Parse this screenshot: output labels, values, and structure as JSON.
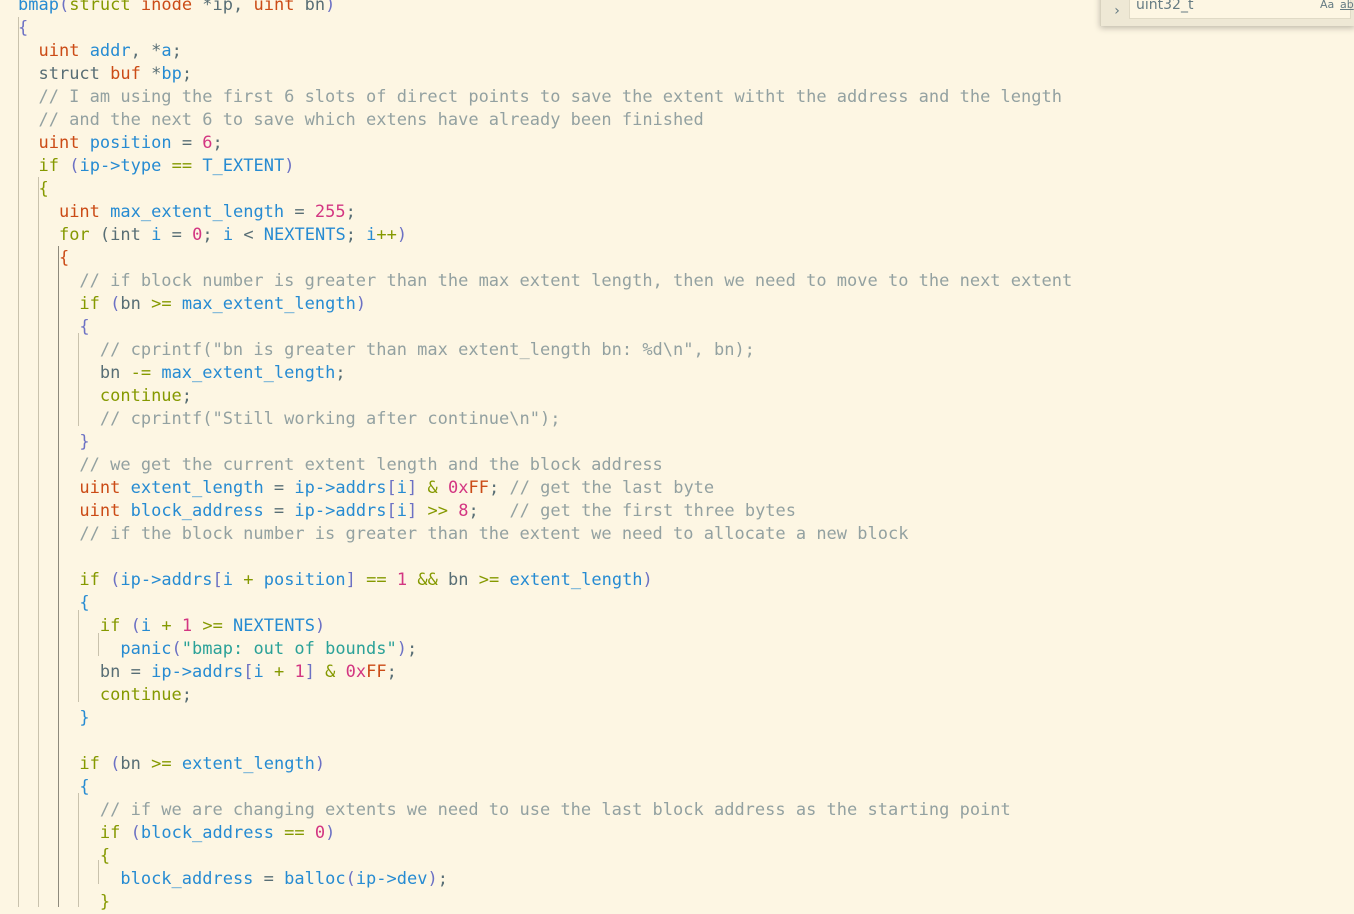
{
  "colors": {
    "background": "#fdf6e3",
    "text": "#586e75",
    "keyword": "#859900",
    "type": "#cb4b16",
    "variable": "#268bd2",
    "number": "#d33682",
    "string": "#2aa198",
    "comment": "#93a1a1",
    "bracket": "#6c71c4"
  },
  "find_widget": {
    "value": "uint32_t",
    "toggle_icon": "chevron-right-icon",
    "match_case_label": "Aa",
    "whole_word_label": "ab"
  },
  "code_lines": [
    [
      [
        "bmap",
        "#268bd2"
      ],
      [
        "(",
        "#6c71c4"
      ],
      [
        "struct",
        "#859900"
      ],
      [
        " ",
        "#586e75"
      ],
      [
        "inode",
        "#cb4b16"
      ],
      [
        " *ip, ",
        "#586e75"
      ],
      [
        "uint",
        "#cb4b16"
      ],
      [
        " bn",
        "#586e75"
      ],
      [
        ")",
        "#6c71c4"
      ]
    ],
    [
      [
        "{",
        "#6c71c4"
      ]
    ],
    [
      [
        "  ",
        "#586e75"
      ],
      [
        "uint",
        "#cb4b16"
      ],
      [
        " ",
        "#586e75"
      ],
      [
        "addr",
        "#268bd2"
      ],
      [
        ", *",
        "#586e75"
      ],
      [
        "a",
        "#268bd2"
      ],
      [
        ";",
        "#586e75"
      ]
    ],
    [
      [
        "  ",
        "#586e75"
      ],
      [
        "struct",
        "#586e75"
      ],
      [
        " ",
        "#586e75"
      ],
      [
        "buf",
        "#cb4b16"
      ],
      [
        " *",
        "#586e75"
      ],
      [
        "bp",
        "#268bd2"
      ],
      [
        ";",
        "#586e75"
      ]
    ],
    [
      [
        "  // I am using the first 6 slots of direct points to save the extent witht the address and the length",
        "#93a1a1"
      ]
    ],
    [
      [
        "  // and the next 6 to save which extens have already been finished",
        "#93a1a1"
      ]
    ],
    [
      [
        "  ",
        "#586e75"
      ],
      [
        "uint",
        "#cb4b16"
      ],
      [
        " ",
        "#586e75"
      ],
      [
        "position",
        "#268bd2"
      ],
      [
        " = ",
        "#586e75"
      ],
      [
        "6",
        "#d33682"
      ],
      [
        ";",
        "#586e75"
      ]
    ],
    [
      [
        "  ",
        "#586e75"
      ],
      [
        "if",
        "#859900"
      ],
      [
        " ",
        "#586e75"
      ],
      [
        "(",
        "#6c71c4"
      ],
      [
        "ip->type",
        "#268bd2"
      ],
      [
        " == ",
        "#859900"
      ],
      [
        "T_EXTENT",
        "#268bd2"
      ],
      [
        ")",
        "#6c71c4"
      ]
    ],
    [
      [
        "  ",
        "#586e75"
      ],
      [
        "{",
        "#859900"
      ]
    ],
    [
      [
        "    ",
        "#586e75"
      ],
      [
        "uint",
        "#cb4b16"
      ],
      [
        " ",
        "#586e75"
      ],
      [
        "max_extent_length",
        "#268bd2"
      ],
      [
        " = ",
        "#586e75"
      ],
      [
        "255",
        "#d33682"
      ],
      [
        ";",
        "#586e75"
      ]
    ],
    [
      [
        "    ",
        "#586e75"
      ],
      [
        "for",
        "#859900"
      ],
      [
        " (",
        "#586e75"
      ],
      [
        "int",
        "#586e75"
      ],
      [
        " ",
        "#586e75"
      ],
      [
        "i",
        "#268bd2"
      ],
      [
        " = ",
        "#586e75"
      ],
      [
        "0",
        "#d33682"
      ],
      [
        "; ",
        "#586e75"
      ],
      [
        "i",
        "#268bd2"
      ],
      [
        " < ",
        "#586e75"
      ],
      [
        "NEXTENTS",
        "#268bd2"
      ],
      [
        "; ",
        "#586e75"
      ],
      [
        "i",
        "#268bd2"
      ],
      [
        "++",
        "#859900"
      ],
      [
        ")",
        "#6c71c4"
      ]
    ],
    [
      [
        "    ",
        "#586e75"
      ],
      [
        "{",
        "#cb4b16"
      ]
    ],
    [
      [
        "      // if block number is greater than the max extent length, then we need to move to the next extent",
        "#93a1a1"
      ]
    ],
    [
      [
        "      ",
        "#586e75"
      ],
      [
        "if",
        "#859900"
      ],
      [
        " ",
        "#586e75"
      ],
      [
        "(",
        "#6c71c4"
      ],
      [
        "bn",
        "#586e75"
      ],
      [
        " >= ",
        "#859900"
      ],
      [
        "max_extent_length",
        "#268bd2"
      ],
      [
        ")",
        "#6c71c4"
      ]
    ],
    [
      [
        "      ",
        "#586e75"
      ],
      [
        "{",
        "#6c71c4"
      ]
    ],
    [
      [
        "        // cprintf(\"bn is greater than max extent_length bn: %d\\n\", bn);",
        "#93a1a1"
      ]
    ],
    [
      [
        "        ",
        "#586e75"
      ],
      [
        "bn",
        "#586e75"
      ],
      [
        " -= ",
        "#859900"
      ],
      [
        "max_extent_length",
        "#268bd2"
      ],
      [
        ";",
        "#586e75"
      ]
    ],
    [
      [
        "        ",
        "#586e75"
      ],
      [
        "continue",
        "#859900"
      ],
      [
        ";",
        "#586e75"
      ]
    ],
    [
      [
        "        // cprintf(\"Still working after continue\\n\");",
        "#93a1a1"
      ]
    ],
    [
      [
        "      ",
        "#586e75"
      ],
      [
        "}",
        "#6c71c4"
      ]
    ],
    [
      [
        "      // we get the current extent length and the block address",
        "#93a1a1"
      ]
    ],
    [
      [
        "      ",
        "#586e75"
      ],
      [
        "uint",
        "#cb4b16"
      ],
      [
        " ",
        "#586e75"
      ],
      [
        "extent_length",
        "#268bd2"
      ],
      [
        " = ",
        "#586e75"
      ],
      [
        "ip->addrs",
        "#268bd2"
      ],
      [
        "[",
        "#6c71c4"
      ],
      [
        "i",
        "#268bd2"
      ],
      [
        "]",
        "#6c71c4"
      ],
      [
        " & ",
        "#859900"
      ],
      [
        "0x",
        "#d33682"
      ],
      [
        "FF",
        "#cb4b16"
      ],
      [
        "; ",
        "#586e75"
      ],
      [
        "// get the last byte",
        "#93a1a1"
      ]
    ],
    [
      [
        "      ",
        "#586e75"
      ],
      [
        "uint",
        "#cb4b16"
      ],
      [
        " ",
        "#586e75"
      ],
      [
        "block_address",
        "#268bd2"
      ],
      [
        " = ",
        "#586e75"
      ],
      [
        "ip->addrs",
        "#268bd2"
      ],
      [
        "[",
        "#6c71c4"
      ],
      [
        "i",
        "#268bd2"
      ],
      [
        "]",
        "#6c71c4"
      ],
      [
        " >> ",
        "#859900"
      ],
      [
        "8",
        "#d33682"
      ],
      [
        ";   ",
        "#586e75"
      ],
      [
        "// get the first three bytes",
        "#93a1a1"
      ]
    ],
    [
      [
        "      // if the block number is greater than the extent we need to allocate a new block",
        "#93a1a1"
      ]
    ],
    [
      [
        "",
        "#586e75"
      ]
    ],
    [
      [
        "      ",
        "#586e75"
      ],
      [
        "if",
        "#859900"
      ],
      [
        " ",
        "#586e75"
      ],
      [
        "(",
        "#6c71c4"
      ],
      [
        "ip->addrs",
        "#268bd2"
      ],
      [
        "[",
        "#6c71c4"
      ],
      [
        "i",
        "#268bd2"
      ],
      [
        " + ",
        "#859900"
      ],
      [
        "position",
        "#268bd2"
      ],
      [
        "]",
        "#6c71c4"
      ],
      [
        " == ",
        "#859900"
      ],
      [
        "1",
        "#d33682"
      ],
      [
        " && ",
        "#859900"
      ],
      [
        "bn",
        "#586e75"
      ],
      [
        " >= ",
        "#859900"
      ],
      [
        "extent_length",
        "#268bd2"
      ],
      [
        ")",
        "#6c71c4"
      ]
    ],
    [
      [
        "      ",
        "#586e75"
      ],
      [
        "{",
        "#268bd2"
      ]
    ],
    [
      [
        "        ",
        "#586e75"
      ],
      [
        "if",
        "#859900"
      ],
      [
        " ",
        "#586e75"
      ],
      [
        "(",
        "#6c71c4"
      ],
      [
        "i",
        "#268bd2"
      ],
      [
        " + ",
        "#859900"
      ],
      [
        "1",
        "#d33682"
      ],
      [
        " >= ",
        "#859900"
      ],
      [
        "NEXTENTS",
        "#268bd2"
      ],
      [
        ")",
        "#6c71c4"
      ]
    ],
    [
      [
        "          ",
        "#586e75"
      ],
      [
        "panic",
        "#268bd2"
      ],
      [
        "(",
        "#6c71c4"
      ],
      [
        "\"bmap: out of bounds\"",
        "#2aa198"
      ],
      [
        ")",
        "#6c71c4"
      ],
      [
        ";",
        "#586e75"
      ]
    ],
    [
      [
        "        ",
        "#586e75"
      ],
      [
        "bn",
        "#586e75"
      ],
      [
        " = ",
        "#586e75"
      ],
      [
        "ip->addrs",
        "#268bd2"
      ],
      [
        "[",
        "#6c71c4"
      ],
      [
        "i",
        "#268bd2"
      ],
      [
        " + ",
        "#859900"
      ],
      [
        "1",
        "#d33682"
      ],
      [
        "]",
        "#6c71c4"
      ],
      [
        " & ",
        "#859900"
      ],
      [
        "0x",
        "#d33682"
      ],
      [
        "FF",
        "#cb4b16"
      ],
      [
        ";",
        "#586e75"
      ]
    ],
    [
      [
        "        ",
        "#586e75"
      ],
      [
        "continue",
        "#859900"
      ],
      [
        ";",
        "#586e75"
      ]
    ],
    [
      [
        "      ",
        "#586e75"
      ],
      [
        "}",
        "#268bd2"
      ]
    ],
    [
      [
        "",
        "#586e75"
      ]
    ],
    [
      [
        "      ",
        "#586e75"
      ],
      [
        "if",
        "#859900"
      ],
      [
        " ",
        "#586e75"
      ],
      [
        "(",
        "#6c71c4"
      ],
      [
        "bn",
        "#586e75"
      ],
      [
        " >= ",
        "#859900"
      ],
      [
        "extent_length",
        "#268bd2"
      ],
      [
        ")",
        "#6c71c4"
      ]
    ],
    [
      [
        "      ",
        "#586e75"
      ],
      [
        "{",
        "#268bd2"
      ]
    ],
    [
      [
        "        // if we are changing extents we need to use the last block address as the starting point",
        "#93a1a1"
      ]
    ],
    [
      [
        "        ",
        "#586e75"
      ],
      [
        "if",
        "#859900"
      ],
      [
        " ",
        "#586e75"
      ],
      [
        "(",
        "#6c71c4"
      ],
      [
        "block_address",
        "#268bd2"
      ],
      [
        " == ",
        "#859900"
      ],
      [
        "0",
        "#d33682"
      ],
      [
        ")",
        "#6c71c4"
      ]
    ],
    [
      [
        "        ",
        "#586e75"
      ],
      [
        "{",
        "#859900"
      ]
    ],
    [
      [
        "          ",
        "#586e75"
      ],
      [
        "block_address",
        "#268bd2"
      ],
      [
        " = ",
        "#586e75"
      ],
      [
        "balloc",
        "#268bd2"
      ],
      [
        "(",
        "#6c71c4"
      ],
      [
        "ip->dev",
        "#268bd2"
      ],
      [
        ")",
        "#6c71c4"
      ],
      [
        ";",
        "#586e75"
      ]
    ],
    [
      [
        "        ",
        "#586e75"
      ],
      [
        "}",
        "#859900"
      ]
    ]
  ]
}
